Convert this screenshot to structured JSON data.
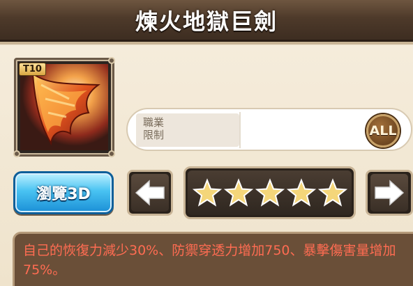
{
  "header": {
    "title": "煉火地獄巨劍"
  },
  "item": {
    "tier": "T10",
    "icon": "flame-greatsword-icon"
  },
  "class_restriction": {
    "label_line1": "職業",
    "label_line2": "限制",
    "badge": "ALL"
  },
  "buttons": {
    "view3d_label": "瀏覽3D",
    "prev_icon": "arrow-left-icon",
    "next_icon": "arrow-right-icon"
  },
  "rating": {
    "stars": 5,
    "max_stars": 5
  },
  "description": {
    "text": "自己的恢復力減少30%、防禦穿透力增加750、暴擊傷害量增加75%。"
  },
  "colors": {
    "title_bar": "#4e3a2a",
    "description_text": "#ff6c52",
    "view3d_button": "#2a9fe0",
    "star_gold": "#f4d67a"
  }
}
